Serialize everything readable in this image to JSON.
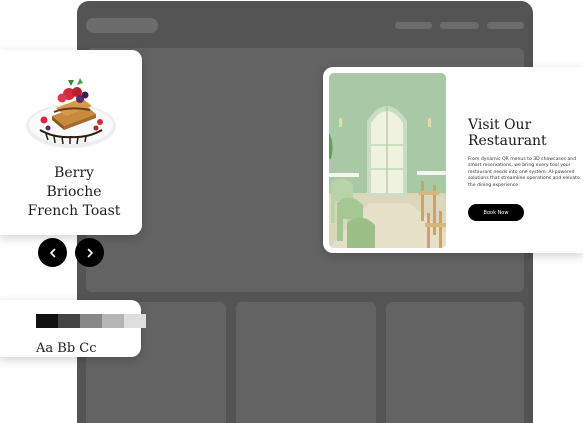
{
  "dish": {
    "title": "Berry\nBrioche\nFrench Toast",
    "image_icon": "french-toast-plate-image"
  },
  "carousel": {
    "prev_icon": "chevron-left-icon",
    "next_icon": "chevron-right-icon"
  },
  "style_guide": {
    "swatch_colors": [
      "#111111",
      "#444444",
      "#888888",
      "#b5b5b5",
      "#dedede"
    ],
    "type_sample": "Aa Bb Cc"
  },
  "restaurant": {
    "title": "Visit Our\nRestaurant",
    "description": "From dynamic QR menus to 3D showcases and smart reservations, we bring every tool your restaurant needs into one system. AI-powered solutions that streamline operations and elevate the dining experience.",
    "book_label": "Book Now",
    "image_icon": "restaurant-interior-image"
  },
  "colors": {
    "browser_frame": "#545454",
    "placeholder": "#636363",
    "accent_button": "#000000",
    "interior_green": "#9fc4a0"
  }
}
